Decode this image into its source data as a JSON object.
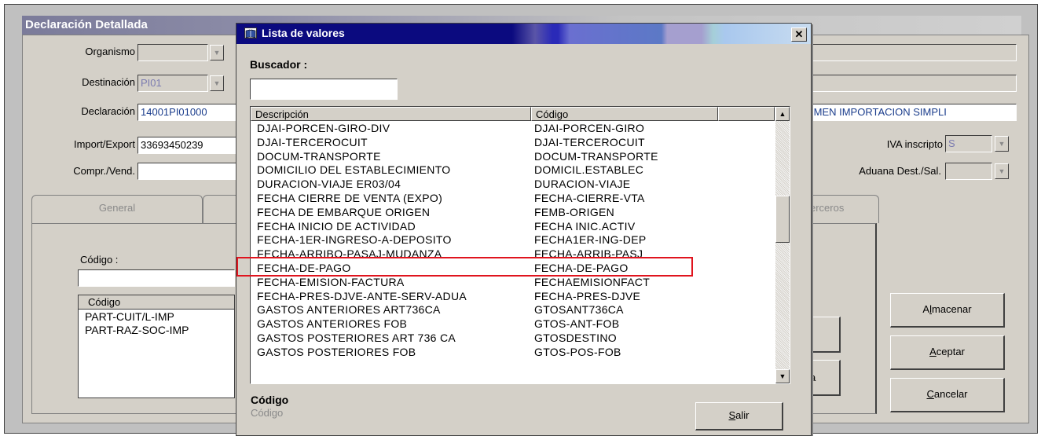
{
  "main_window": {
    "title": "Declaración Detallada",
    "labels": {
      "organismo": "Organismo",
      "destinacion": "Destinación",
      "declaracion": "Declaración",
      "import_export": "Import/Export",
      "compr_vend": "Compr./Vend.",
      "iva_inscripto": "IVA inscripto",
      "aduana_dest": "Aduana Dest./Sal."
    },
    "values": {
      "organismo": "",
      "destinacion": "PI01",
      "declaracion": "14001PI01000",
      "import_export": "33693450239",
      "compr_vend": "",
      "regimen": "IMEN IMPORTACION SIMPLI",
      "iva_inscripto": "S",
      "aduana_dest": ""
    },
    "tabs": [
      "General",
      "erceros"
    ],
    "codigo_label": "Código :",
    "codigo_input": "",
    "codigo_list_header": "Código",
    "codigo_items": [
      "PART-CUIT/L-IMP",
      "PART-RAZ-SOC-IMP"
    ],
    "partial_button_text": "a",
    "buttons": {
      "almacenar": {
        "pre": "A",
        "ul": "l",
        "post": "macenar"
      },
      "aceptar": {
        "pre": "",
        "ul": "A",
        "post": "ceptar"
      },
      "cancelar": {
        "pre": "",
        "ul": "C",
        "post": "ancelar"
      }
    }
  },
  "dialog": {
    "title": "Lista de valores",
    "close_glyph": "✕",
    "search_label": "Buscador :",
    "search_value": "",
    "columns": [
      "Descripción",
      "Código"
    ],
    "rows": [
      [
        "DJAI-PORCEN-GIRO-DIV",
        "DJAI-PORCEN-GIRO"
      ],
      [
        "DJAI-TERCEROCUIT",
        "DJAI-TERCEROCUIT"
      ],
      [
        "DOCUM-TRANSPORTE",
        "DOCUM-TRANSPORTE"
      ],
      [
        "DOMICILIO DEL ESTABLECIMIENTO",
        "DOMICIL.ESTABLEC"
      ],
      [
        "DURACION-VIAJE ER03/04",
        "DURACION-VIAJE"
      ],
      [
        "FECHA CIERRE DE VENTA (EXPO)",
        "FECHA-CIERRE-VTA"
      ],
      [
        "FECHA DE EMBARQUE ORIGEN",
        "FEMB-ORIGEN"
      ],
      [
        "FECHA INICIO DE ACTIVIDAD",
        "FECHA INIC.ACTIV"
      ],
      [
        "FECHA-1ER-INGRESO-A-DEPOSITO",
        "FECHA1ER-ING-DEP"
      ],
      [
        "FECHA-ARRIBO-PASAJ-MUDANZA",
        "FECHA-ARRIB-PASJ"
      ],
      [
        "FECHA-DE-PAGO",
        "FECHA-DE-PAGO"
      ],
      [
        "FECHA-EMISION-FACTURA",
        "FECHAEMISIONFACT"
      ],
      [
        "FECHA-PRES-DJVE-ANTE-SERV-ADUA",
        "FECHA-PRES-DJVE"
      ],
      [
        "GASTOS ANTERIORES ART736CA",
        "GTOSANT736CA"
      ],
      [
        "GASTOS ANTERIORES FOB",
        "GTOS-ANT-FOB"
      ],
      [
        "GASTOS POSTERIORES ART 736 CA",
        "GTOSDESTINO"
      ],
      [
        "GASTOS POSTERIORES FOB",
        "GTOS-POS-FOB"
      ]
    ],
    "highlighted_row": 9,
    "status_title": "Código",
    "status_value": "Código",
    "salir": {
      "ul": "S",
      "post": "alir"
    }
  },
  "colors": {
    "dialog_title_bar": "#0b0a7f",
    "highlight_box": "#e0141e",
    "window_face": "#d4d0c8",
    "dark_blue_text": "#1b3d8c"
  }
}
